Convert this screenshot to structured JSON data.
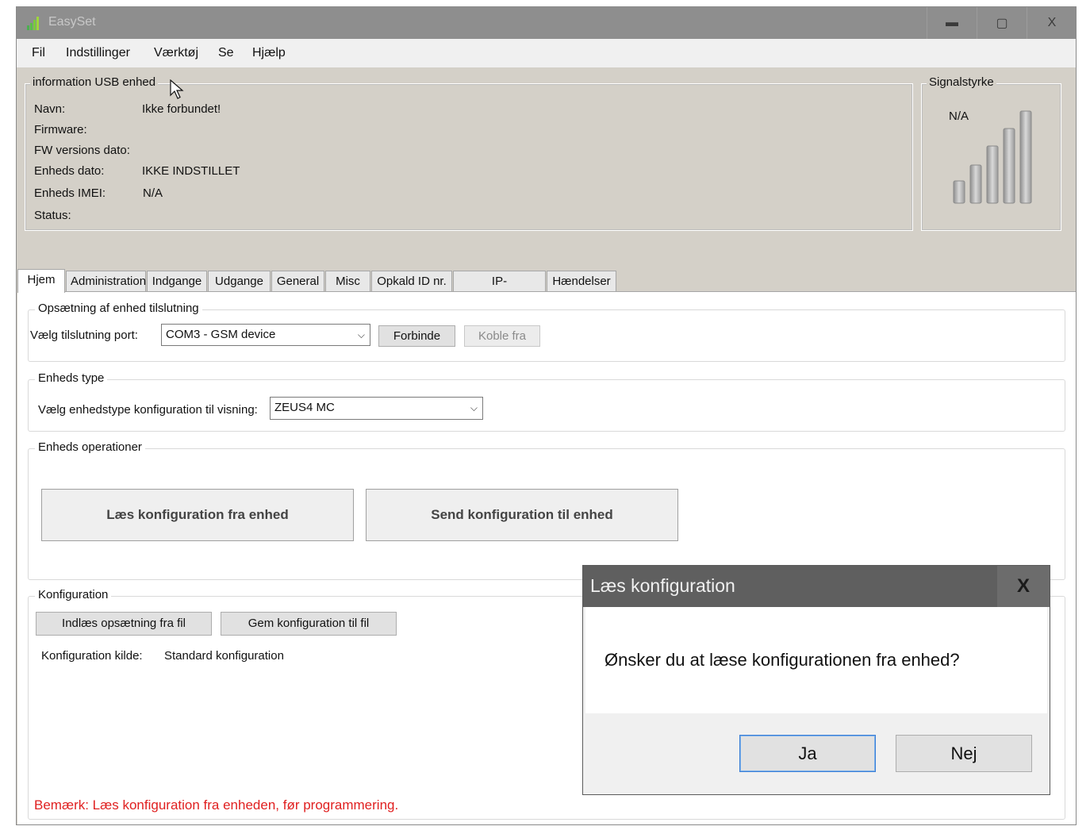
{
  "window": {
    "title": "EasySet",
    "controls": {
      "minimize": "▬",
      "maximize": "▢",
      "close": "X"
    }
  },
  "menu": [
    "Fil",
    "Indstillinger",
    "Værktøj",
    "Se",
    "Hjælp"
  ],
  "usb_info": {
    "legend": "information USB enhed",
    "rows": [
      {
        "label": "Navn:",
        "value": "Ikke forbundet!"
      },
      {
        "label": "Firmware:",
        "value": ""
      },
      {
        "label": "FW versions dato:",
        "value": ""
      },
      {
        "label": "Enheds dato:",
        "value": "IKKE INDSTILLET"
      },
      {
        "label": "Enheds IMEI:",
        "value": "N/A"
      },
      {
        "label": "Status:",
        "value": ""
      }
    ]
  },
  "signal": {
    "legend": "Signalstyrke",
    "value": "N/A",
    "bars": 5
  },
  "tabs": [
    "Hjem",
    "Administration",
    "Indgange",
    "Udgange",
    "General",
    "Misc",
    "Opkald ID nr.",
    "IP-konfiguration",
    "Hændelser"
  ],
  "connection": {
    "legend": "Opsætning af enhed tilslutning",
    "port_label": "Vælg tilslutning port:",
    "port_value": "COM3 - GSM device",
    "connect": "Forbinde",
    "disconnect": "Koble fra"
  },
  "device_type": {
    "legend": "Enheds type",
    "label": "Vælg enhedstype konfiguration til visning:",
    "value": "ZEUS4 MC"
  },
  "operations": {
    "legend": "Enheds operationer",
    "read": "Læs konfiguration fra enhed",
    "send": "Send konfiguration til enhed"
  },
  "configuration": {
    "legend": "Konfiguration",
    "load": "Indlæs opsætning fra fil",
    "save": "Gem konfiguration til fil",
    "source_label": "Konfiguration kilde:",
    "source_value": "Standard konfiguration"
  },
  "note": "Bemærk: Læs konfiguration fra enheden, før programmering.",
  "dialog": {
    "title": "Læs konfiguration",
    "close": "X",
    "message": "Ønsker du at læse konfigurationen fra enhed?",
    "yes": "Ja",
    "no": "Nej"
  },
  "colors": {
    "title_bar": "#8e8e8e",
    "window_bg": "#d4d0c8",
    "note": "#e02020",
    "dialog_title": "#5f5f5f"
  }
}
